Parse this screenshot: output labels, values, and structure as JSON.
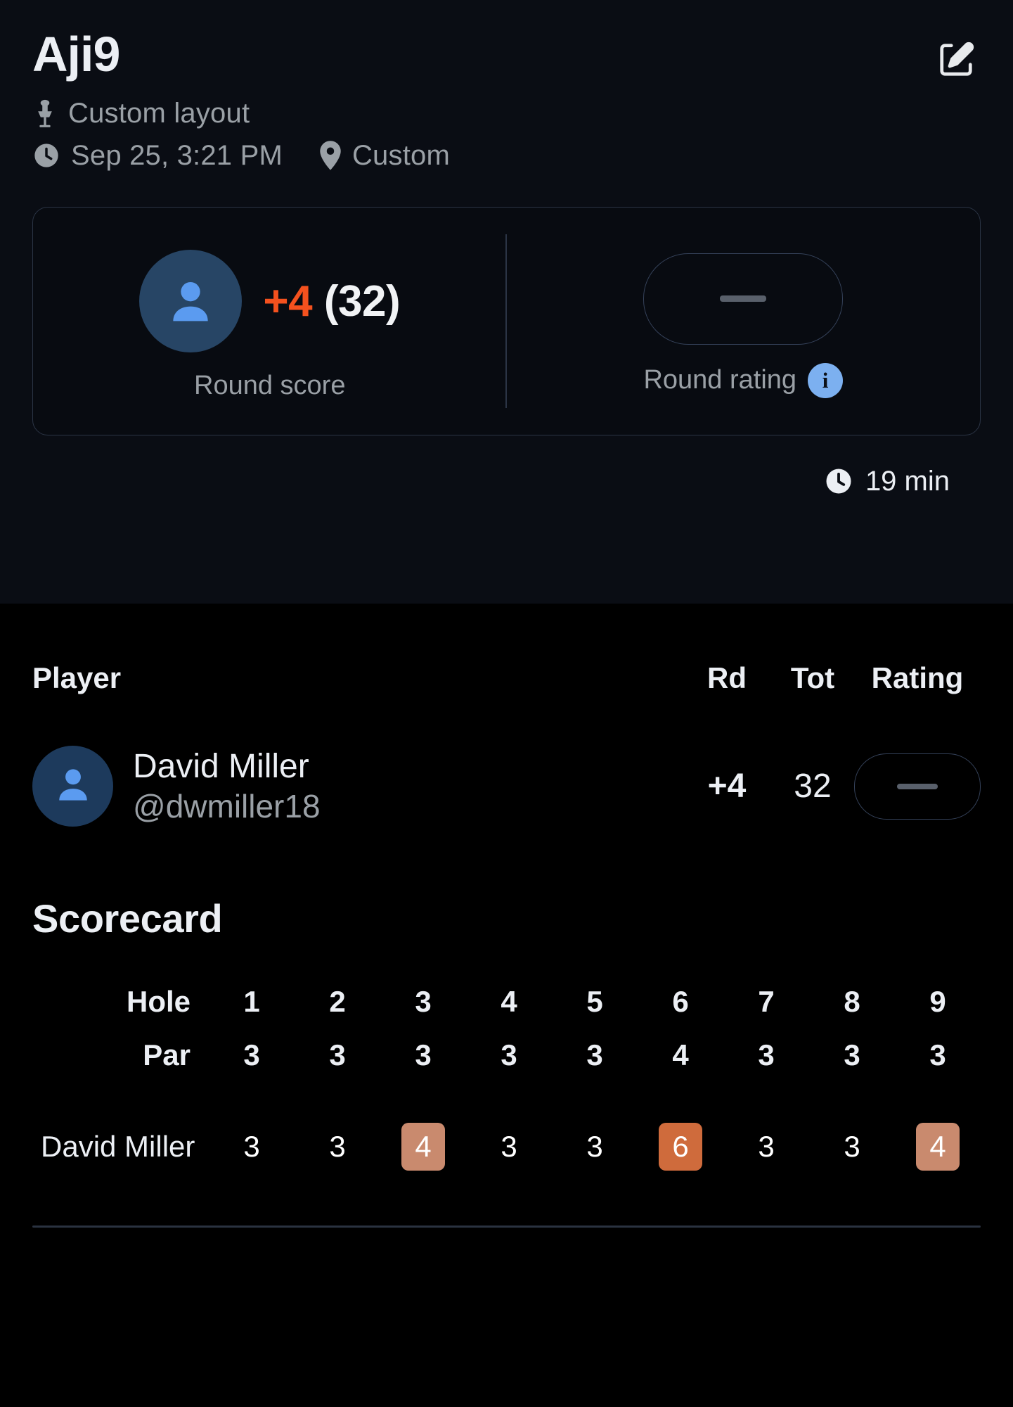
{
  "header": {
    "title": "Aji9",
    "edit_icon": "edit-square-icon",
    "layout": {
      "icon": "disc-golf-basket-icon",
      "text": "Custom layout"
    },
    "datetime": {
      "icon": "clock-icon",
      "text": "Sep 25, 3:21 PM"
    },
    "location": {
      "icon": "map-pin-icon",
      "text": "Custom"
    }
  },
  "stats": {
    "round_score": {
      "avatar_icon": "person-icon",
      "relative": "+4",
      "total": "(32)",
      "label": "Round score"
    },
    "round_rating": {
      "value": "—",
      "label": "Round rating",
      "info_icon": "info-icon",
      "info_glyph": "i"
    },
    "duration": {
      "icon": "clock-filled-icon",
      "text": "19 min"
    }
  },
  "leaderboard": {
    "columns": {
      "player": "Player",
      "rd": "Rd",
      "tot": "Tot",
      "rating": "Rating"
    },
    "rows": [
      {
        "avatar_icon": "person-icon",
        "name": "David Miller",
        "handle": "@dwmiller18",
        "rd": "+4",
        "tot": "32",
        "rating": "—"
      }
    ]
  },
  "scorecard": {
    "title": "Scorecard",
    "hole_label": "Hole",
    "par_label": "Par",
    "holes": [
      "1",
      "2",
      "3",
      "4",
      "5",
      "6",
      "7",
      "8",
      "9"
    ],
    "pars": [
      "3",
      "3",
      "3",
      "3",
      "3",
      "4",
      "3",
      "3",
      "3"
    ],
    "players": [
      {
        "name": "David Miller",
        "scores": [
          "3",
          "3",
          "4",
          "3",
          "3",
          "6",
          "3",
          "3",
          "4"
        ],
        "marks": [
          "plain",
          "plain",
          "bogey",
          "plain",
          "plain",
          "double",
          "plain",
          "plain",
          "bogey"
        ]
      }
    ]
  },
  "colors": {
    "accent_orange": "#f4511e",
    "bogey": "#c98a6e",
    "double_bogey": "#cf6b3c",
    "info_blue": "#7cb0f0",
    "hero_bg": "#0a0d14",
    "page_bg": "#000000"
  }
}
